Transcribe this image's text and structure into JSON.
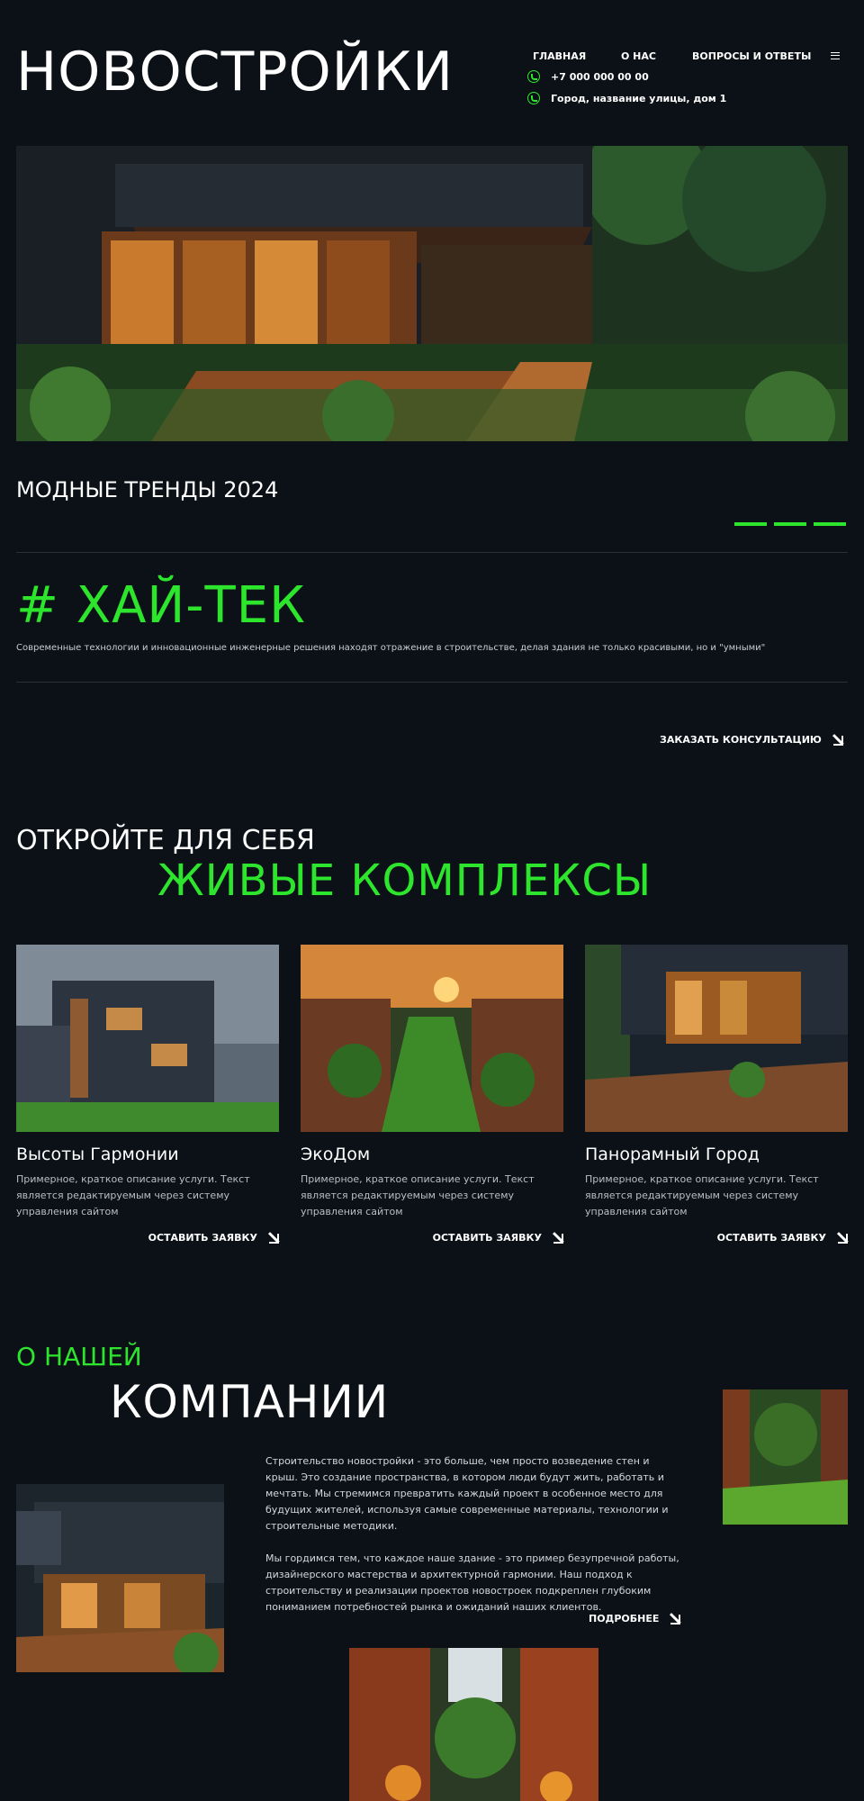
{
  "header": {
    "logo": "НОВОСТРОЙКИ",
    "nav": [
      "ГЛАВНАЯ",
      "О НАС",
      "ВОПРОСЫ И ОТВЕТЫ"
    ],
    "phone": "+7 000 000 00 00",
    "address": "Город, название улицы, дом 1"
  },
  "trends": {
    "title": "МОДНЫЕ ТРЕНДЫ 2024",
    "style": "# ХАЙ-ТЕК",
    "description": "Современные технологии и инновационные инженерные решения находят отражение в строительстве, делая здания не только красивыми, но и \"умными\"",
    "cta": "ЗАКАЗАТЬ КОНСУЛЬТАЦИЮ"
  },
  "complexes": {
    "heading_line1": "ОТКРОЙТЕ ДЛЯ СЕБЯ",
    "heading_line2": "ЖИВЫЕ КОМПЛЕКСЫ",
    "cards": [
      {
        "title": "Высоты Гармонии",
        "desc": "Примерное, краткое описание услуги. Текст является редактируемым через систему управления сайтом",
        "cta": "ОСТАВИТЬ ЗАЯВКУ"
      },
      {
        "title": "ЭкоДом",
        "desc": "Примерное, краткое описание услуги. Текст является редактируемым через систему управления сайтом",
        "cta": "ОСТАВИТЬ ЗАЯВКУ"
      },
      {
        "title": "Панорамный Город",
        "desc": "Примерное, краткое описание услуги. Текст является редактируемым через систему управления сайтом",
        "cta": "ОСТАВИТЬ ЗАЯВКУ"
      }
    ]
  },
  "about": {
    "heading_line1": "О НАШЕЙ",
    "heading_line2": "КОМПАНИИ",
    "paragraph1": "Строительство новостройки - это больше, чем просто возведение стен и крыш. Это создание пространства, в котором люди будут жить, работать и мечтать. Мы стремимся превратить каждый проект в особенное место для будущих жителей, используя самые современные материалы, технологии и строительные методики.",
    "paragraph2": "Мы гордимся тем, что каждое наше здание - это пример безупречной работы, дизайнерского мастерства и архитектурной гармонии. Наш подход к строительству и реализации проектов новостроек подкреплен глубоким пониманием потребностей рынка и ожиданий наших клиентов.",
    "cta": "ПОДРОБНЕЕ"
  },
  "colors": {
    "accent": "#2de52d",
    "background": "#0b1117"
  }
}
